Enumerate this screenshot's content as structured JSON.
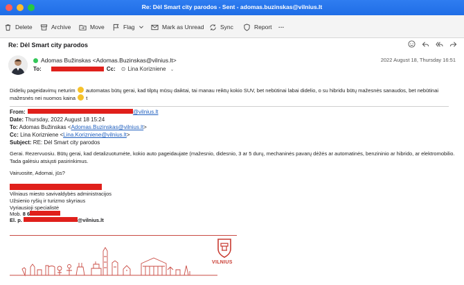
{
  "window": {
    "title": "Re: Dėl Smart city parodos - Sent - adomas.buzinskas@vilnius.lt"
  },
  "toolbar": {
    "delete": "Delete",
    "archive": "Archive",
    "move": "Move",
    "flag": "Flag",
    "mark_unread": "Mark as Unread",
    "sync": "Sync",
    "report": "Report",
    "more": "···"
  },
  "email": {
    "subject": "Re: Dėl Smart city parodos",
    "from": "Adomas Bužinskas <Adomas.Buzinskas@vilnius.lt>",
    "to_label": "To:",
    "cc_label": "Cc:",
    "cc_name": "Lina Korizniene",
    "date": "2022 August 18, Thursday 16:51",
    "body_line1_a": "Didelių pageidavimų neturim",
    "body_line1_b": "automatas būtų gerai, kad tilptų mūsų daiktai, tai manau reiktų kokio SUV, bet nebūtinai labai didelio, o su hibridu būtų mažesnės sanaudos, bet nebūtinai",
    "body_line2_a": "mažesnės nei nuomos kaina",
    "body_line2_b": "t"
  },
  "quoted": {
    "from_label": "From:",
    "from_email": "@vilnius.lt",
    "date_label": "Date:",
    "date_value": "Thursday, 2022 August 18 15:24",
    "to_label": "To:",
    "to_name": "Adomas Bužinskas <",
    "to_email": "Adomas.Buzinskas@vilnius.lt",
    "to_close": ">",
    "cc_label": "Cc:",
    "cc_name": "Lina Korizniene <",
    "cc_email": "Lina.Korizniene@vilnius.lt",
    "cc_close": ">",
    "subject_label": "Subject:",
    "subject_value": "RE: Dėl Smart city parodos",
    "body1": "Gerai. Rezervuosiu. Būtų gerai, kad detalizuotumėte, kokio auto pageidaujate (mažesnio, didesnio, 3 ar 5 durų, mechaninės pavarų dėžės ar automatinės, benzininio ar hibrido, ar elektromobilio.",
    "body2": "Tada galėsiu atsiųsti pasirinkimus.",
    "greeting": "Vairuosite, Adomai, jūs?"
  },
  "signature": {
    "org": "Vilniaus miesto savivaldybės administracijos",
    "dept": "Užsienio ryšių ir turizmo skyriaus",
    "title": "Vyriausioji specialistė",
    "mob_label": "Mob.",
    "mob_value": "8 6",
    "email_label": "El. p.",
    "email_value": "@vilnius.lt",
    "brand": "VILNIUS"
  },
  "colors": {
    "titlebar": "#2f7df0",
    "redaction": "#e0201b",
    "brand": "#c83a30"
  }
}
